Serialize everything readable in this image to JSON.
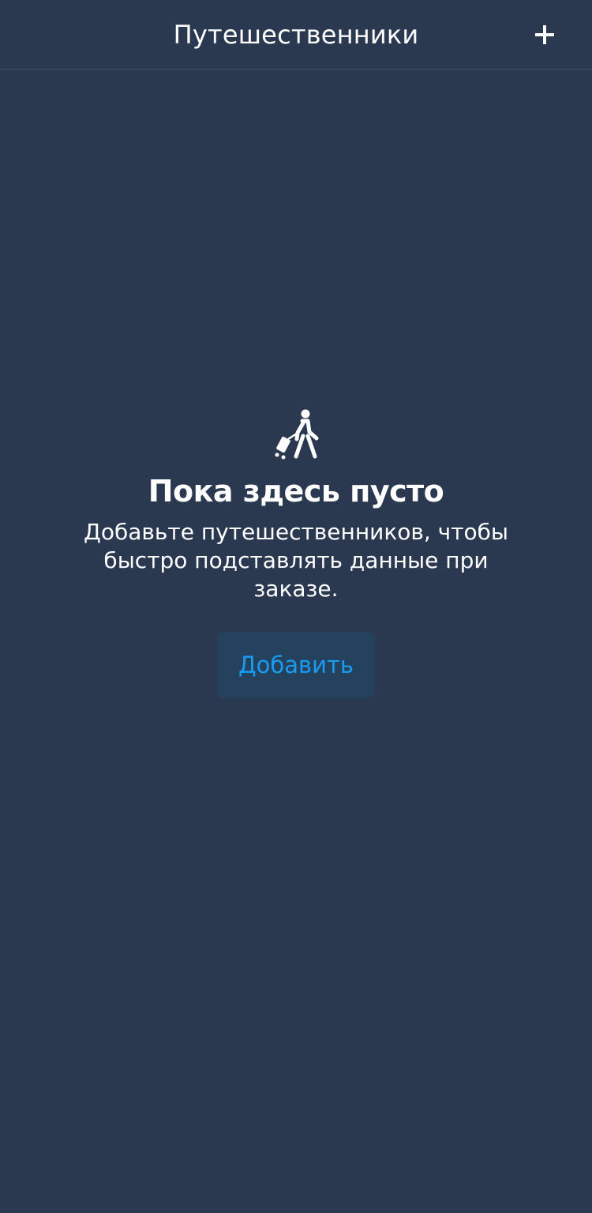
{
  "header": {
    "title": "Путешественники",
    "add_icon": "plus-icon"
  },
  "empty_state": {
    "icon": "traveler-with-suitcase-icon",
    "title": "Пока здесь пусто",
    "text": "Добавьте путешественников, чтобы быстро подставлять данные при заказе.",
    "button_label": "Добавить"
  },
  "colors": {
    "background": "#2a3950",
    "divider": "#46546a",
    "button_background": "#24415e",
    "accent": "#1a9bf2",
    "text": "#ffffff"
  }
}
